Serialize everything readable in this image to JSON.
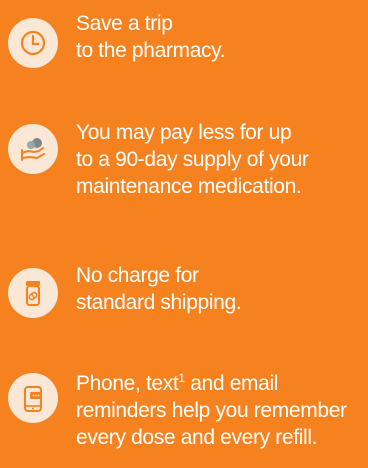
{
  "benefits": [
    {
      "icon": "clock-icon",
      "lines": [
        "Save a trip",
        "to the pharmacy."
      ]
    },
    {
      "icon": "hand-money-icon",
      "lines": [
        "You may pay less for up",
        "to a 90-day supply of your",
        "maintenance medication."
      ]
    },
    {
      "icon": "pill-bottle-icon",
      "lines": [
        "No charge for",
        "standard shipping."
      ]
    },
    {
      "icon": "phone-reminder-icon",
      "lines": [
        "reminders help you remember",
        "every dose and every refill."
      ],
      "first_line_before_sup": "Phone, text",
      "first_line_sup": "1",
      "first_line_after_sup": " and email"
    }
  ],
  "colors": {
    "background": "#f5821f",
    "icon_circle": "#fbe7d6",
    "icon_stroke": "#f5821f",
    "text": "#ffffff"
  }
}
